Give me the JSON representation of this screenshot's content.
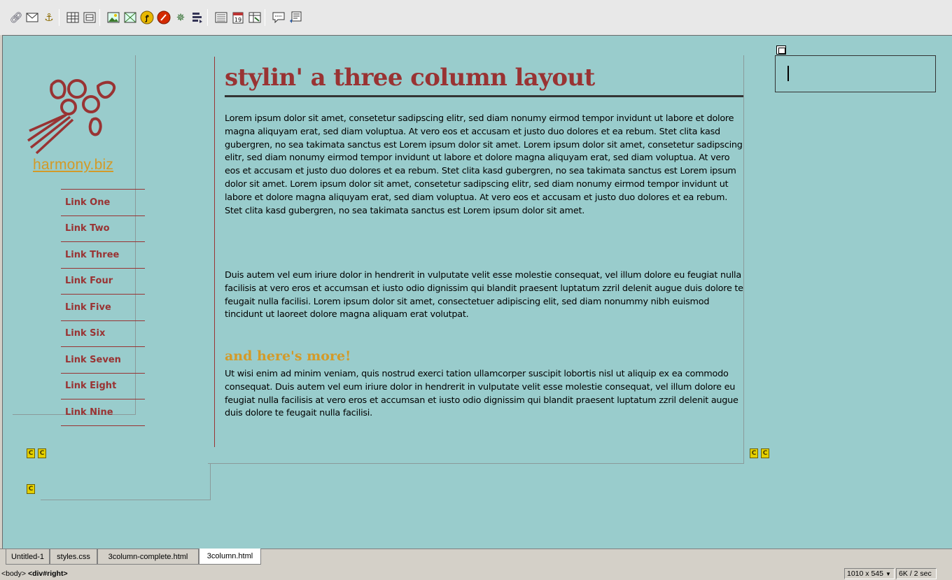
{
  "toolbar": {
    "icons": [
      "hyperlink-icon",
      "email-link-icon",
      "named-anchor-icon",
      "table-icon",
      "layer-icon",
      "image-icon",
      "image-placeholder-icon",
      "flash-icon",
      "shockwave-icon",
      "fireworks-icon",
      "navigation-bar-icon",
      "horizontal-rule-icon",
      "date-icon",
      "tabular-data-icon",
      "comment-icon",
      "tag-chooser-icon"
    ]
  },
  "logo": {
    "text": "harmony.biz"
  },
  "nav": {
    "items": [
      "Link One",
      "Link Two",
      "Link Three",
      "Link Four",
      "Link Five",
      "Link Six",
      "Link Seven",
      "Link Eight",
      "Link Nine"
    ]
  },
  "content": {
    "title": "stylin' a three column layout",
    "para1": "Lorem ipsum dolor sit amet, consetetur sadipscing elitr, sed diam nonumy eirmod tempor invidunt ut labore et dolore magna aliquyam erat, sed diam voluptua. At vero eos et accusam et justo duo dolores et ea rebum. Stet clita kasd gubergren, no sea takimata sanctus est Lorem ipsum dolor sit amet. Lorem ipsum dolor sit amet, consetetur sadipscing elitr, sed diam nonumy eirmod tempor invidunt ut labore et dolore magna aliquyam erat, sed diam voluptua. At vero eos et accusam et justo duo dolores et ea rebum. Stet clita kasd gubergren, no sea takimata sanctus est Lorem ipsum dolor sit amet. Lorem ipsum dolor sit amet, consetetur sadipscing elitr, sed diam nonumy eirmod tempor invidunt ut labore et dolore magna aliquyam erat, sed diam voluptua. At vero eos et accusam et justo duo dolores et ea rebum. Stet clita kasd gubergren, no sea takimata sanctus est Lorem ipsum dolor sit amet.",
    "para2": "Duis autem vel eum iriure dolor in hendrerit in vulputate velit esse molestie consequat, vel illum dolore eu feugiat nulla facilisis at vero eros et accumsan et iusto odio dignissim qui blandit praesent luptatum zzril delenit augue duis dolore te feugait nulla facilisi. Lorem ipsum dolor sit amet, consectetuer adipiscing elit, sed diam nonummy nibh euismod tincidunt ut laoreet dolore magna aliquam erat volutpat.",
    "subhead": "and here's more!",
    "para3": "Ut wisi enim ad minim veniam, quis nostrud exerci tation ullamcorper suscipit lobortis nisl ut aliquip ex ea commodo consequat. Duis autem vel eum iriure dolor in hendrerit in vulputate velit esse molestie consequat, vel illum dolore eu feugiat nulla facilisis at vero eros et accumsan et iusto odio dignissim qui blandit praesent luptatum zzril delenit augue duis dolore te feugait nulla facilisi."
  },
  "markers": {
    "glyph": "C"
  },
  "tabs": [
    "Untitled-1",
    "styles.css",
    "3column-complete.html",
    "3column.html"
  ],
  "active_tab": "3column.html",
  "status": {
    "tag_body": "<body>",
    "tag_current": "<div#right>",
    "window_size": "1010 x 545",
    "download_stats": "6K / 2 sec"
  },
  "colors": {
    "canvas_bg": "#99cccc",
    "accent": "#993333",
    "gold": "#d39a28"
  }
}
